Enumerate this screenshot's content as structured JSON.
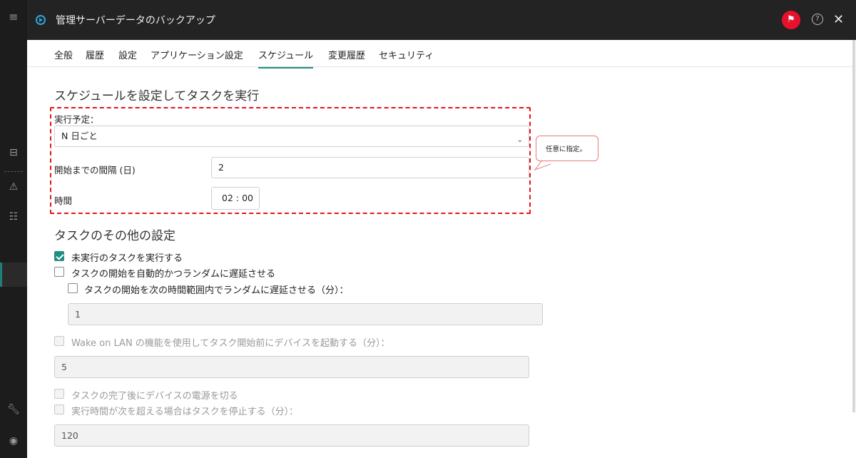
{
  "window": {
    "title": "管理サーバーデータのバックアップ",
    "flag_icon": "flag-icon",
    "help_label": "?",
    "close_label": "✕"
  },
  "tabs": [
    {
      "label": "全般"
    },
    {
      "label": "履歴"
    },
    {
      "label": "設定"
    },
    {
      "label": "アプリケーション設定"
    },
    {
      "label": "スケジュール",
      "active": true
    },
    {
      "label": "変更履歴"
    },
    {
      "label": "セキュリティ"
    }
  ],
  "schedule": {
    "heading": "スケジュールを設定してタスクを実行",
    "run_label": "実行予定：",
    "run_value": "N 日ごと",
    "interval_label": "開始までの間隔 (日)",
    "interval_value": "2",
    "time_label": "時間",
    "time_value": "02 : 00"
  },
  "callout": {
    "text": "任意に指定。"
  },
  "other": {
    "heading": "タスクのその他の設定",
    "run_missed": {
      "label": "未実行のタスクを実行する",
      "checked": true
    },
    "random_delay": {
      "label": "タスクの開始を自動的かつランダムに遅延させる",
      "checked": false
    },
    "random_delay_range": {
      "label": "タスクの開始を次の時間範囲内でランダムに遅延させる（分）：",
      "checked": false,
      "value": "1"
    },
    "wol": {
      "label": "Wake on LAN の機能を使用してタスク開始前にデバイスを起動する（分）：",
      "checked": false,
      "value": "5"
    },
    "power_off": {
      "label": "タスクの完了後にデバイスの電源を切る",
      "checked": false
    },
    "stop_if_exceeds": {
      "label": "実行時間が次を超える場合はタスクを停止する（分）：",
      "checked": false,
      "value": "120"
    }
  },
  "colors": {
    "accent": "#1f8f84",
    "highlight": "#e5141d",
    "flag": "#e8112d",
    "titlebar": "#232323"
  }
}
